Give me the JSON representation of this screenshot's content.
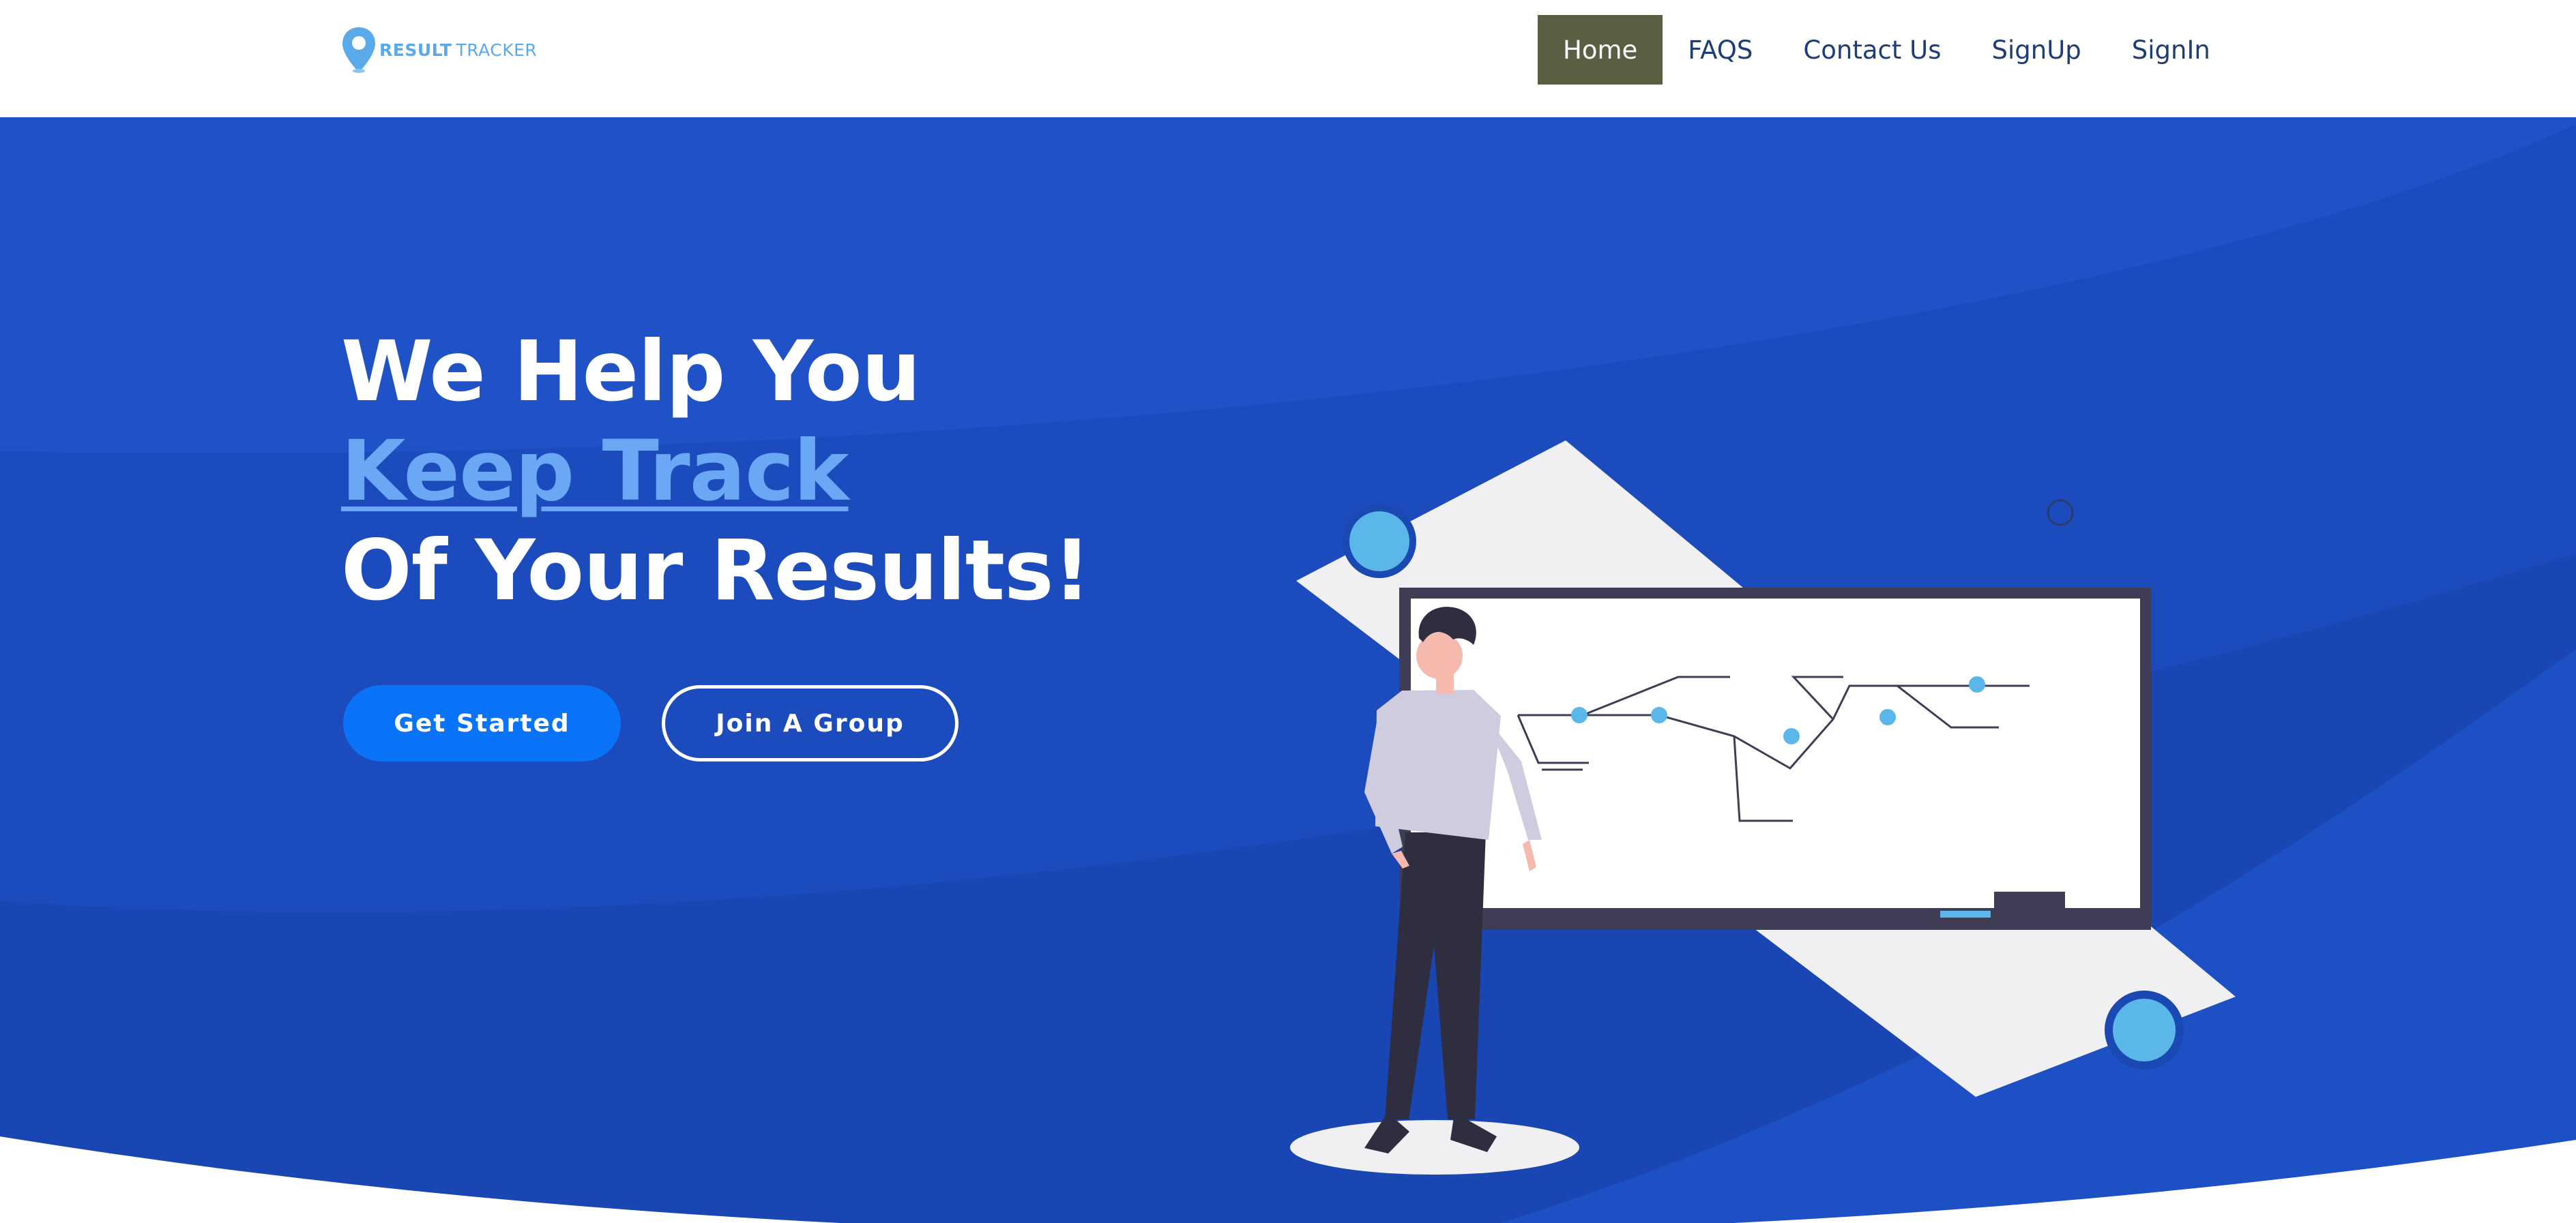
{
  "brand": {
    "name_bold": "RESULT",
    "name_light": "TRACKER",
    "logo_color": "#5aa9e8"
  },
  "nav": {
    "items": [
      {
        "label": "Home",
        "active": true
      },
      {
        "label": "FAQS",
        "active": false
      },
      {
        "label": "Contact Us",
        "active": false
      },
      {
        "label": "SignUp",
        "active": false
      },
      {
        "label": "SignIn",
        "active": false
      }
    ]
  },
  "hero": {
    "line1": "We Help You",
    "line2": "Keep Track",
    "line3": "Of Your Results!",
    "primary_button": "Get Started",
    "secondary_button": "Join A Group"
  },
  "colors": {
    "hero_background": "#1e4fc4",
    "nav_active": "#5a5f44",
    "nav_text": "#1c3d78",
    "accent_text": "#6aa8f5",
    "primary_button": "#0b73f7"
  },
  "icons": {
    "logo": "location-pin-icon"
  }
}
